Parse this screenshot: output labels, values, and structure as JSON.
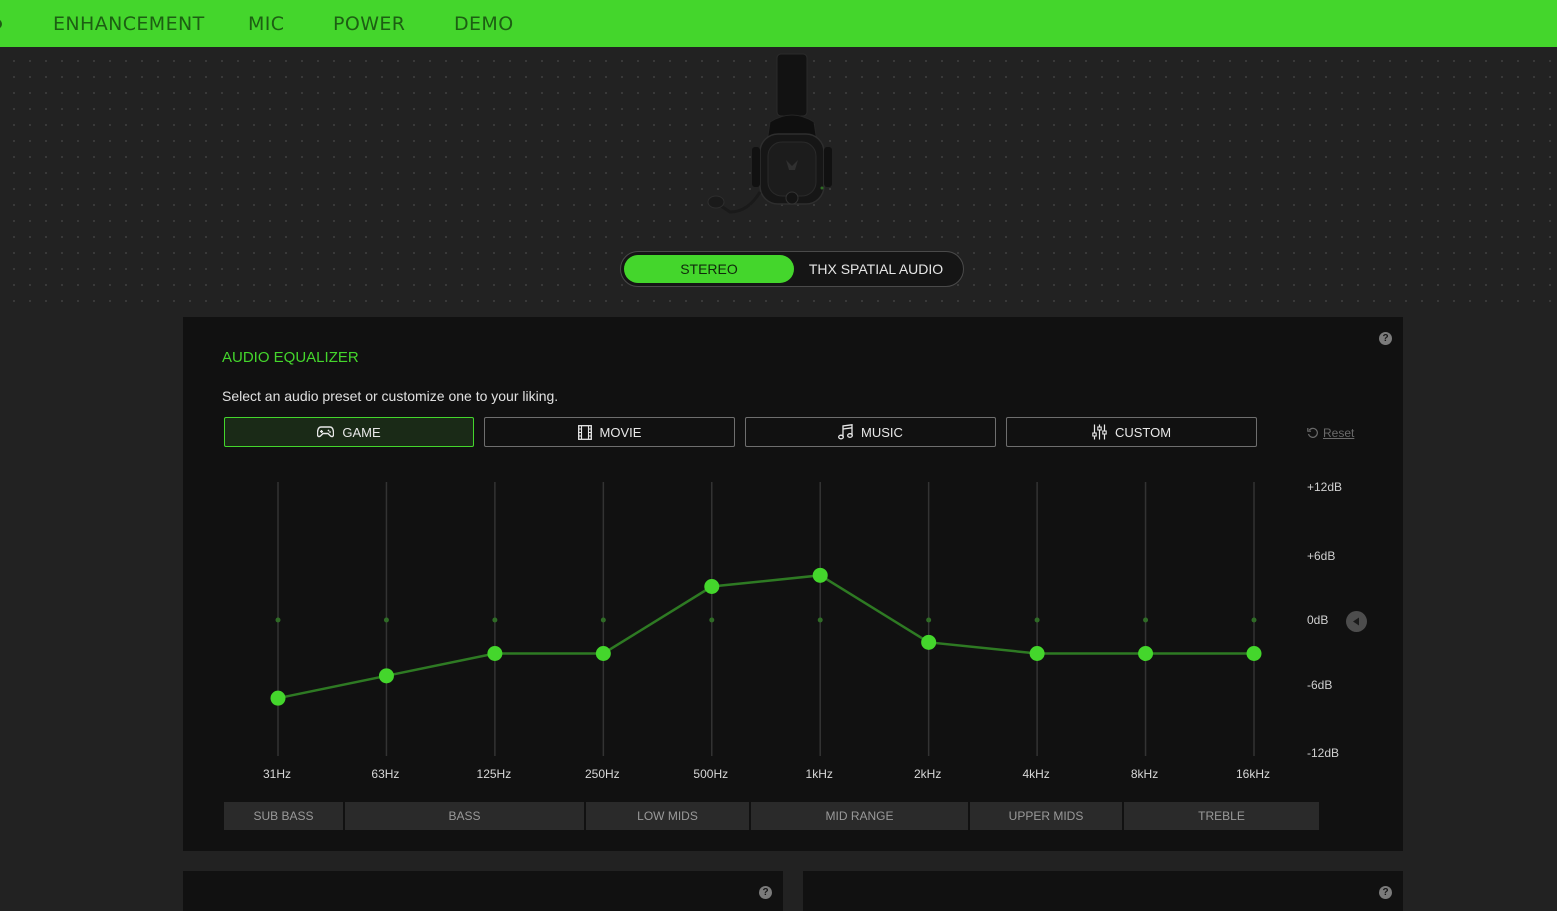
{
  "nav": {
    "tabs": [
      {
        "label": "ENHANCEMENT"
      },
      {
        "label": "MIC"
      },
      {
        "label": "POWER"
      },
      {
        "label": "DEMO"
      }
    ]
  },
  "mode_toggle": {
    "options": [
      "STEREO",
      "THX SPATIAL AUDIO"
    ],
    "selected": "STEREO"
  },
  "equalizer": {
    "title": "AUDIO EQUALIZER",
    "description": "Select an audio preset or customize one to your liking.",
    "presets": [
      {
        "label": "GAME",
        "icon": "gamepad-icon"
      },
      {
        "label": "MOVIE",
        "icon": "film-icon"
      },
      {
        "label": "MUSIC",
        "icon": "music-note-icon"
      },
      {
        "label": "CUSTOM",
        "icon": "sliders-icon"
      }
    ],
    "selected_preset": "GAME",
    "reset_label": "Reset",
    "db_scale": [
      "+12dB",
      "+6dB",
      "0dB",
      "-6dB",
      "-12dB"
    ],
    "bands": [
      {
        "label": "SUB BASS"
      },
      {
        "label": "BASS"
      },
      {
        "label": "LOW MIDS"
      },
      {
        "label": "MID RANGE"
      },
      {
        "label": "UPPER MIDS"
      },
      {
        "label": "TREBLE"
      }
    ]
  },
  "chart_data": {
    "type": "line",
    "x": [
      "31Hz",
      "63Hz",
      "125Hz",
      "250Hz",
      "500Hz",
      "1kHz",
      "2kHz",
      "4kHz",
      "8kHz",
      "16kHz"
    ],
    "values": [
      -7,
      -5,
      -3,
      -3,
      3,
      4,
      -2,
      -3,
      -3,
      -3
    ],
    "ylim": [
      -12,
      12
    ],
    "yticks": [
      "+12dB",
      "+6dB",
      "0dB",
      "-6dB",
      "-12dB"
    ],
    "grid": true
  },
  "colors": {
    "accent": "#44d62c",
    "background": "#222222",
    "panel": "#111111"
  }
}
